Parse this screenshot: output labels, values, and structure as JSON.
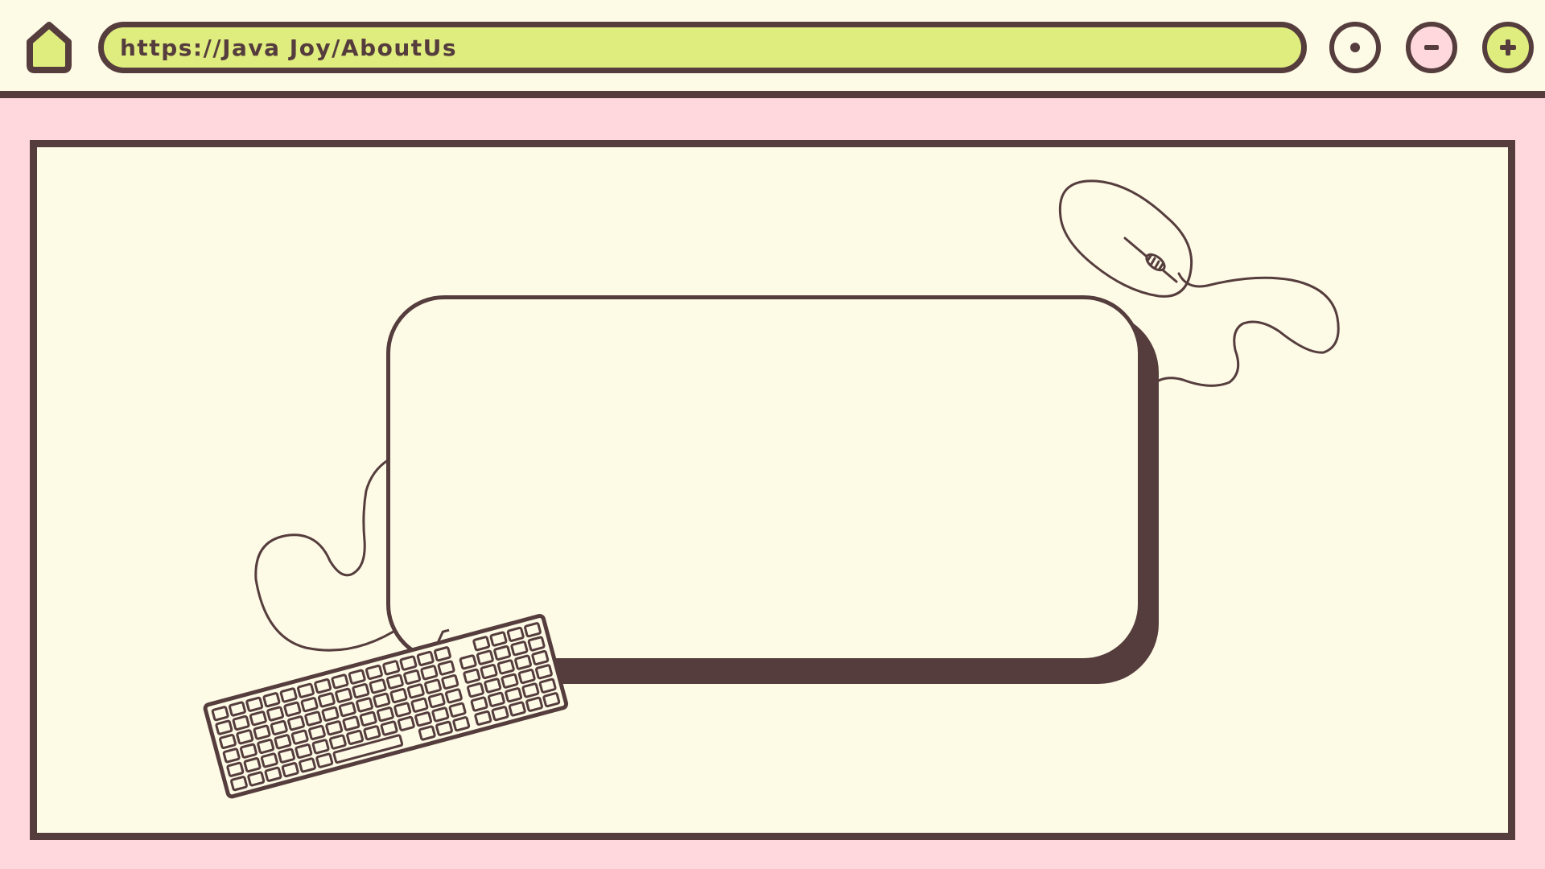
{
  "browser": {
    "url": "https://Java Joy/AboutUs",
    "controls": [
      "dot-button",
      "minimize-button",
      "maximize-button"
    ]
  },
  "icons": {
    "home": "home-icon",
    "dot": "dot-icon",
    "minimize": "minus-icon",
    "maximize": "plus-icon",
    "mouse": "computer-mouse-illustration",
    "keyboard": "keyboard-illustration"
  },
  "colors": {
    "background_pink": "#ffd8de",
    "cream": "#fdfae6",
    "lime": "#dfec7e",
    "brown": "#553d3d"
  }
}
